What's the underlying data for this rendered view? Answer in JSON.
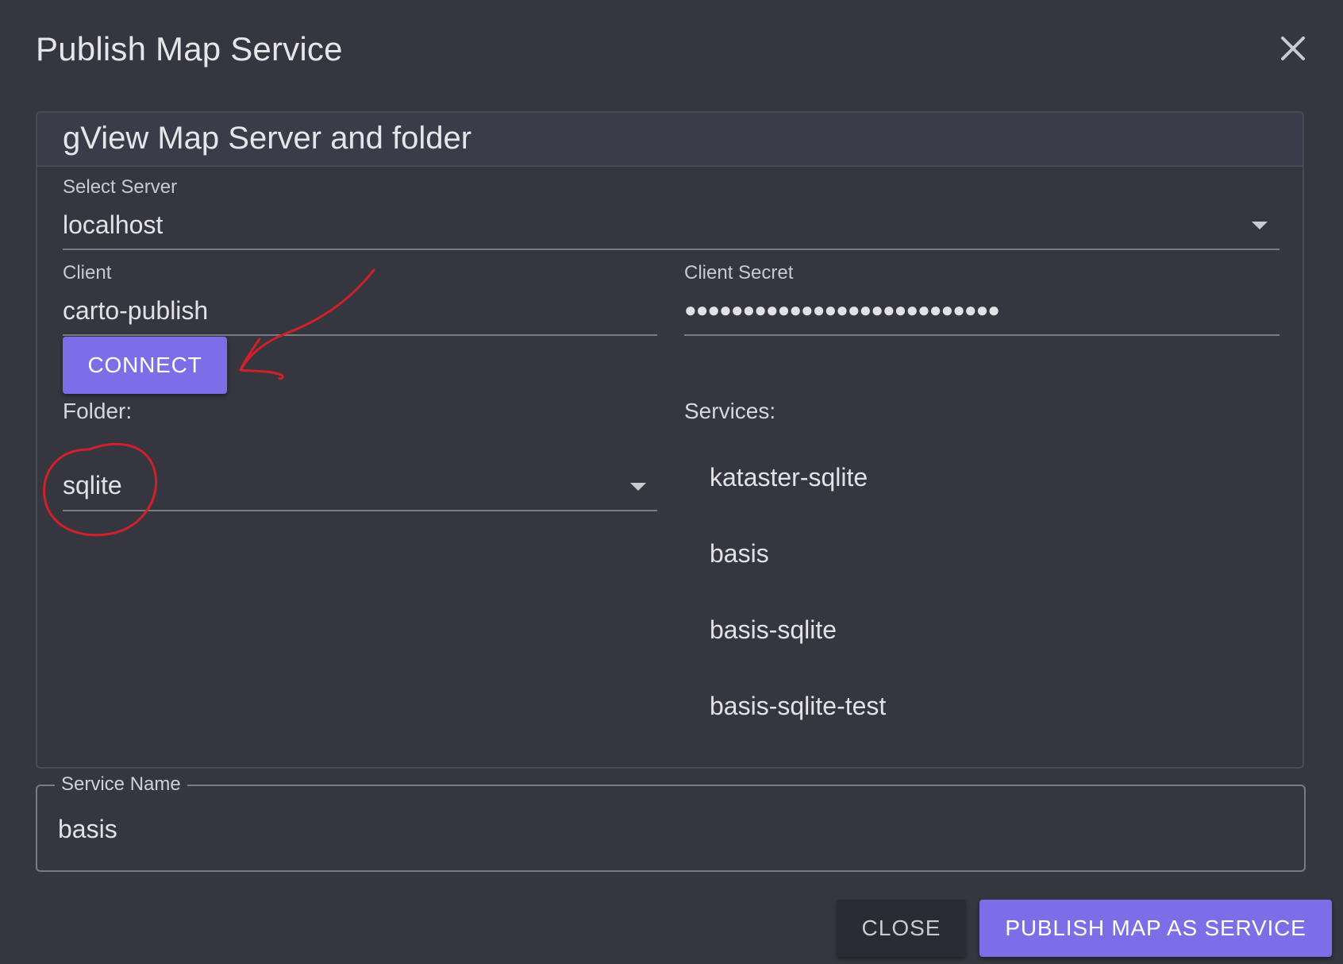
{
  "dialog": {
    "title": "Publish Map Service",
    "close_icon": "close-icon"
  },
  "section": {
    "title": "gView Map Server and folder"
  },
  "server": {
    "label": "Select Server",
    "value": "localhost"
  },
  "client": {
    "label": "Client",
    "value": "carto-publish"
  },
  "client_secret": {
    "label": "Client Secret",
    "value": "●●●●●●●●●●●●●●●●●●●●●●●●●●●"
  },
  "connect_button": {
    "label": "CONNECT"
  },
  "folder": {
    "label": "Folder:",
    "value": "sqlite"
  },
  "services": {
    "label": "Services:",
    "items": [
      "kataster-sqlite",
      "basis",
      "basis-sqlite",
      "basis-sqlite-test"
    ]
  },
  "service_name": {
    "label": "Service Name",
    "value": "basis"
  },
  "actions": {
    "close_label": "CLOSE",
    "publish_label": "PUBLISH MAP AS SERVICE"
  },
  "colors": {
    "background": "#35363f",
    "accent": "#7b6ee6",
    "annotation": "#d0202a"
  }
}
